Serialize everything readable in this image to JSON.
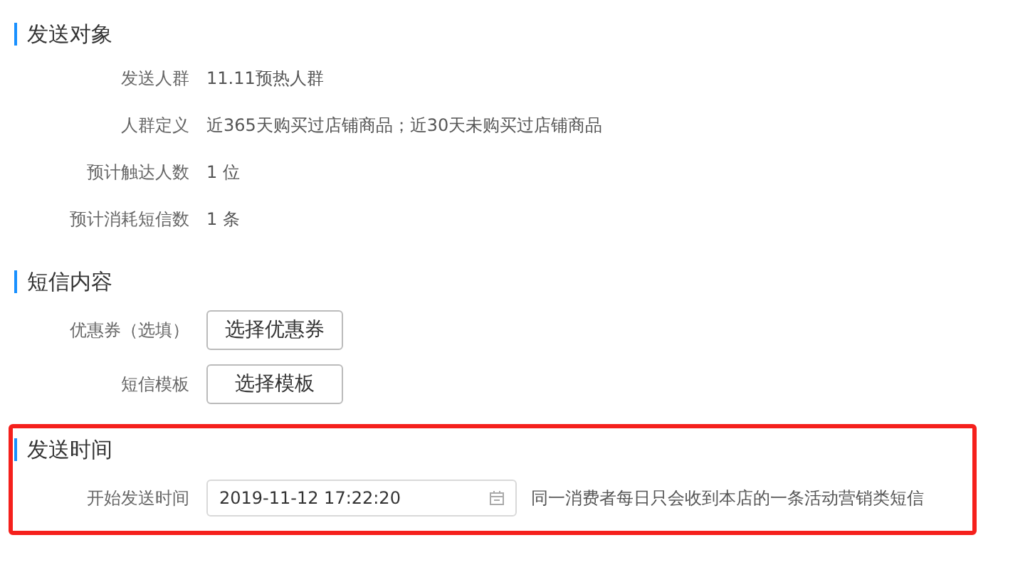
{
  "sections": [
    {
      "title": "发送对象",
      "highlighted": false,
      "rows": [
        {
          "kind": "text",
          "label": "发送人群",
          "value": "11.11预热人群"
        },
        {
          "kind": "text",
          "label": "人群定义",
          "value": "近365天购买过店铺商品；近30天未购买过店铺商品"
        },
        {
          "kind": "text",
          "label": "预计触达人数",
          "value": "1 位"
        },
        {
          "kind": "text",
          "label": "预计消耗短信数",
          "value": "1 条"
        }
      ]
    },
    {
      "title": "短信内容",
      "highlighted": false,
      "rows": [
        {
          "kind": "button",
          "label": "优惠券（选填）",
          "value": "选择优惠券"
        },
        {
          "kind": "button",
          "label": "短信模板",
          "value": "选择模板"
        }
      ]
    },
    {
      "title": "发送时间",
      "highlighted": true,
      "rows": [
        {
          "kind": "datetime",
          "label": "开始发送时间",
          "value": "2019-11-12 17:22:20",
          "hint": "同一消费者每日只会收到本店的一条活动营销类短信"
        }
      ]
    }
  ]
}
